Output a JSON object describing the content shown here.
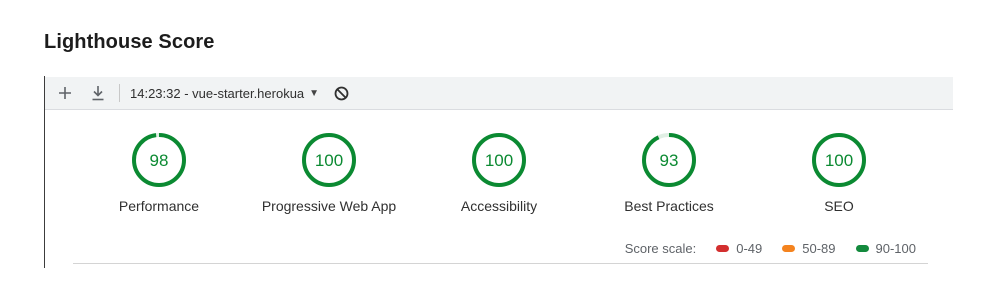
{
  "page": {
    "title": "Lighthouse Score"
  },
  "toolbar": {
    "report_selector": "14:23:32 - vue-starter.herokua",
    "add_icon": "plus-icon",
    "download_icon": "download-icon",
    "clear_icon": "block-icon",
    "dropdown_icon": "caret-down-icon"
  },
  "gauges": [
    {
      "score": 98,
      "value": "98",
      "label": "Performance"
    },
    {
      "score": 100,
      "value": "100",
      "label": "Progressive Web App"
    },
    {
      "score": 100,
      "value": "100",
      "label": "Accessibility"
    },
    {
      "score": 93,
      "value": "93",
      "label": "Best Practices"
    },
    {
      "score": 100,
      "value": "100",
      "label": "SEO"
    }
  ],
  "score_scale": {
    "label": "Score scale:",
    "ranges": [
      {
        "range": "0-49",
        "color": "#d32f2f"
      },
      {
        "range": "50-89",
        "color": "#f4831f"
      },
      {
        "range": "90-100",
        "color": "#138a3d"
      }
    ]
  },
  "colors": {
    "pass": "#0b8a32",
    "gauge_track": "#e0efe4",
    "toolbar_bg": "#f1f3f4"
  }
}
